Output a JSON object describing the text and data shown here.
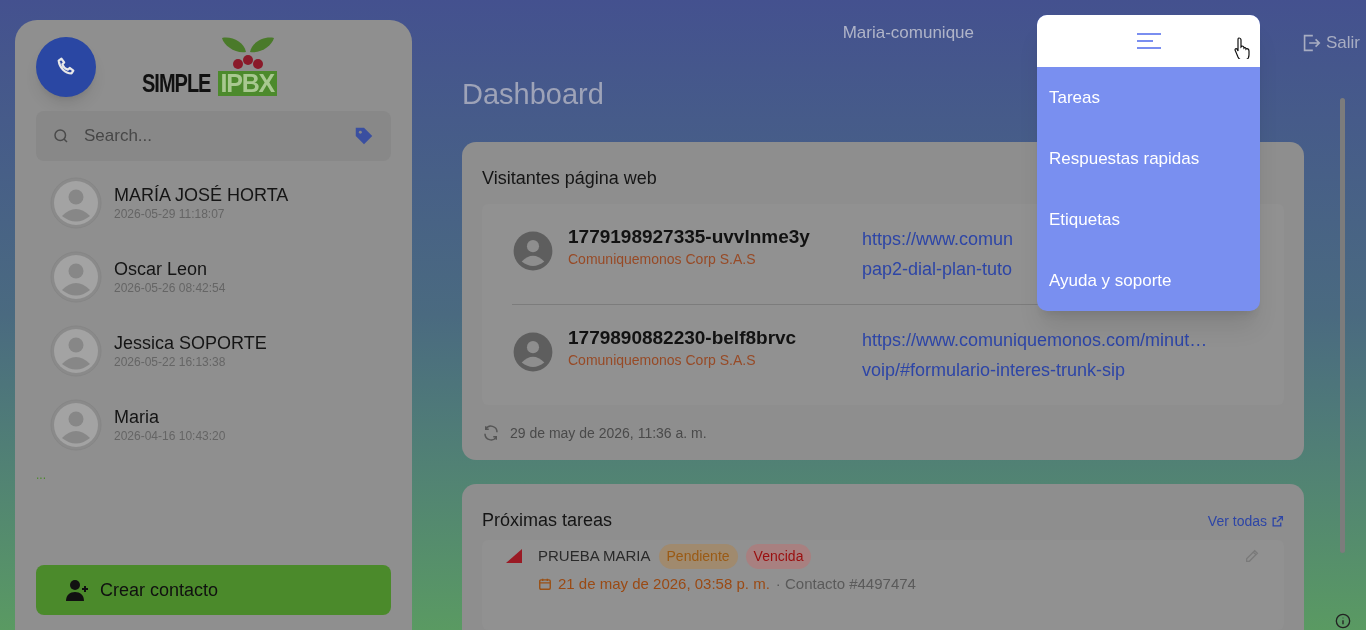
{
  "logo": {
    "word": "SIMPLE",
    "badge": "IPBX"
  },
  "search": {
    "placeholder": "Search..."
  },
  "contacts": [
    {
      "name": "MARÍA JOSÉ HORTA",
      "time": "2026-05-29 11:18:07"
    },
    {
      "name": "Oscar Leon",
      "time": "2026-05-26 08:42:54"
    },
    {
      "name": "Jessica SOPORTE",
      "time": "2026-05-22 16:13:38"
    },
    {
      "name": "Maria",
      "time": "2026-04-16 10:43:20"
    }
  ],
  "more": "...",
  "create_button": "Crear contacto",
  "user": "Maria-comunique",
  "logout": "Salir",
  "page_title": "Dashboard",
  "visitors": {
    "title": "Visitantes página web",
    "items": [
      {
        "id": "1779198927335-uvvlnme3y",
        "company": "Comuniquemonos Corp S.A.S",
        "url_lines": [
          "https://www.comun",
          "pap2-dial-plan-tuto"
        ]
      },
      {
        "id": "1779890882230-belf8brvc",
        "company": "Comuniquemonos Corp S.A.S",
        "url_lines": [
          "https://www.comuniquemonos.com/minut…",
          "voip/#formulario-interes-trunk-sip"
        ]
      }
    ],
    "updated": "29 de may de 2026, 11:36 a. m."
  },
  "tasks": {
    "title": "Próximas tareas",
    "see_all": "Ver todas",
    "items": [
      {
        "name": "PRUEBA MARIA",
        "badges": [
          {
            "label": "Pendiente",
            "kind": "pending"
          },
          {
            "label": "Vencida",
            "kind": "overdue"
          }
        ],
        "date": "21 de may de 2026, 03:58 p. m.",
        "contact": "· Contacto #4497474"
      }
    ]
  },
  "menu": {
    "items": [
      "Tareas",
      "Respuestas rapidas",
      "Etiquetas",
      "Ayuda y soporte"
    ]
  }
}
